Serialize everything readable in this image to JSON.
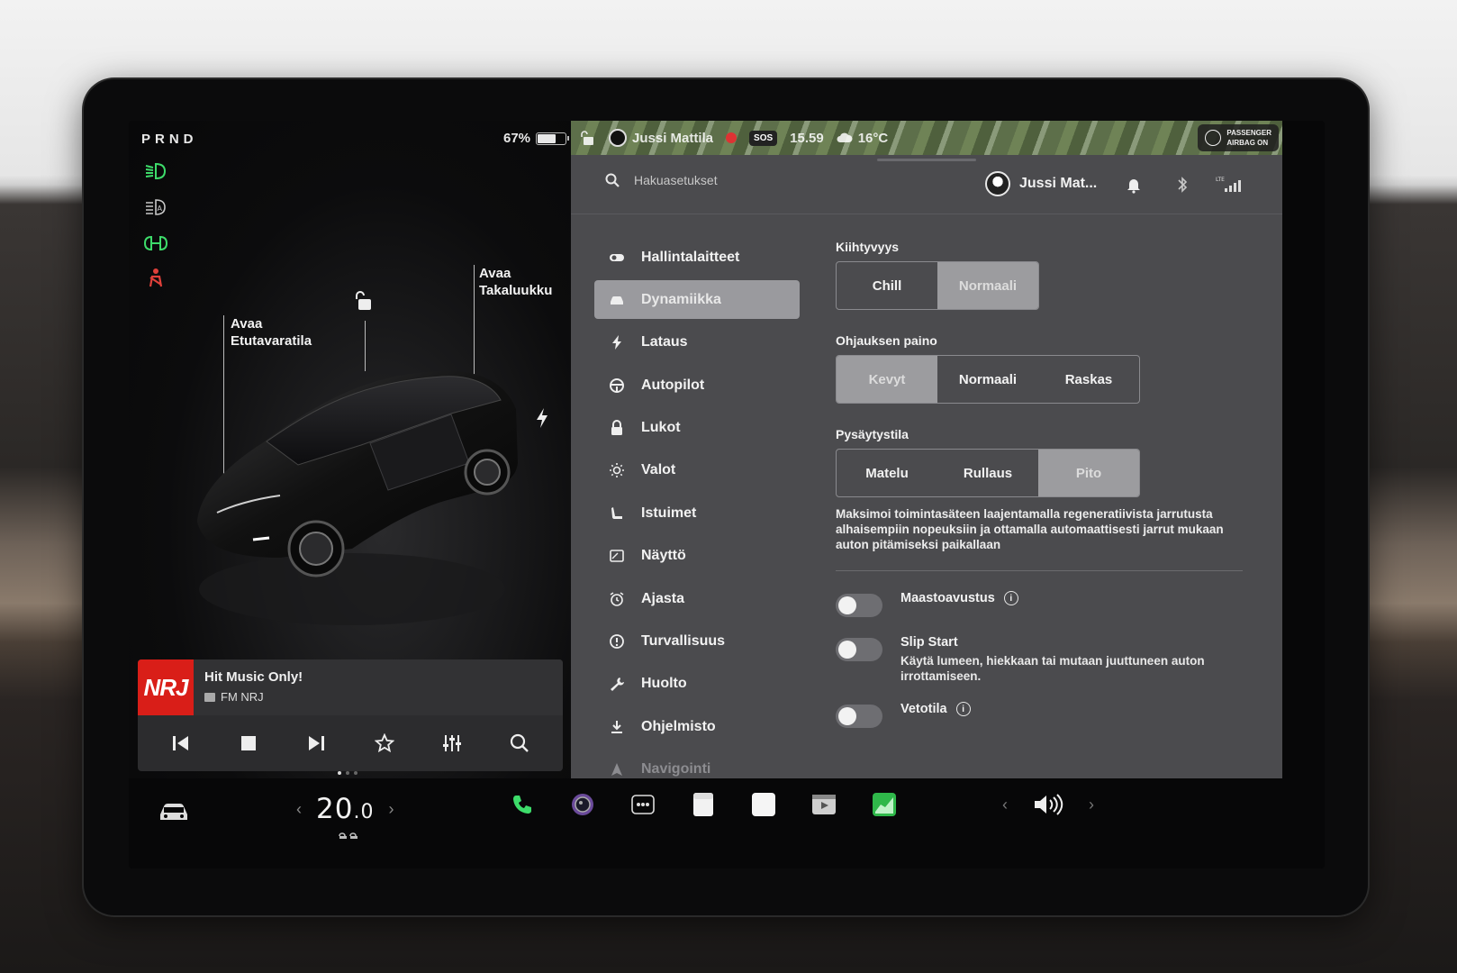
{
  "gear": "PRND",
  "battery": {
    "percent_label": "67%",
    "level": 0.67
  },
  "car_labels": {
    "frunk": "Avaa\nEtutavaratila",
    "trunk": "Avaa\nTakaluukku"
  },
  "media": {
    "logo": "NRJ",
    "song": "Hit Music Only!",
    "station": "FM NRJ"
  },
  "status_bar": {
    "user": "Jussi Mattila",
    "sos": "SOS",
    "time": "15.59",
    "temperature": "16°C",
    "airbag": "PASSENGER\nAIRBAG ON"
  },
  "top": {
    "search_placeholder": "Hakuasetukset",
    "profile_name": "Jussi Mat..."
  },
  "menu": [
    {
      "label": "Hallintalaitteet",
      "icon": "toggle-icon"
    },
    {
      "label": "Dynamiikka",
      "icon": "car-icon"
    },
    {
      "label": "Lataus",
      "icon": "bolt-icon"
    },
    {
      "label": "Autopilot",
      "icon": "steering-wheel-icon"
    },
    {
      "label": "Lukot",
      "icon": "lock-icon"
    },
    {
      "label": "Valot",
      "icon": "sun-icon"
    },
    {
      "label": "Istuimet",
      "icon": "seat-icon"
    },
    {
      "label": "Näyttö",
      "icon": "display-icon"
    },
    {
      "label": "Ajasta",
      "icon": "alarm-icon"
    },
    {
      "label": "Turvallisuus",
      "icon": "info-circle-icon"
    },
    {
      "label": "Huolto",
      "icon": "wrench-icon"
    },
    {
      "label": "Ohjelmisto",
      "icon": "download-icon"
    },
    {
      "label": "Navigointi",
      "icon": "navigation-icon"
    }
  ],
  "menu_active": "Dynamiikka",
  "settings": {
    "acceleration": {
      "title": "Kiihtyvyys",
      "options": [
        "Chill",
        "Normaali"
      ],
      "selected": "Normaali"
    },
    "steering": {
      "title": "Ohjauksen paino",
      "options": [
        "Kevyt",
        "Normaali",
        "Raskas"
      ],
      "selected": "Kevyt"
    },
    "stop_mode": {
      "title": "Pysäytystila",
      "options": [
        "Matelu",
        "Rullaus",
        "Pito"
      ],
      "selected": "Pito",
      "description": "Maksimoi toimintasäteen laajentamalla regeneratiivista jarrutusta alhaisempiin nopeuksiin ja ottamalla automaattisesti jarrut mukaan auton pitämiseksi paikallaan"
    },
    "toggles": [
      {
        "label": "Maastoavustus",
        "info": true,
        "on": false,
        "description": ""
      },
      {
        "label": "Slip Start",
        "info": false,
        "on": false,
        "description": "Käytä lumeen, hiekkaan tai mutaan juuttuneen auton irrottamiseen."
      },
      {
        "label": "Vetotila",
        "info": true,
        "on": false,
        "description": ""
      }
    ]
  },
  "climate": {
    "temperature": "20",
    "decimal": ".0"
  },
  "colors": {
    "indicator_green": "#3ddc6a",
    "indicator_red": "#e0403a",
    "nrj_red": "#d91e18",
    "panel_bg": "#4b4b4e",
    "selected_segment": "#9c9c9f"
  }
}
